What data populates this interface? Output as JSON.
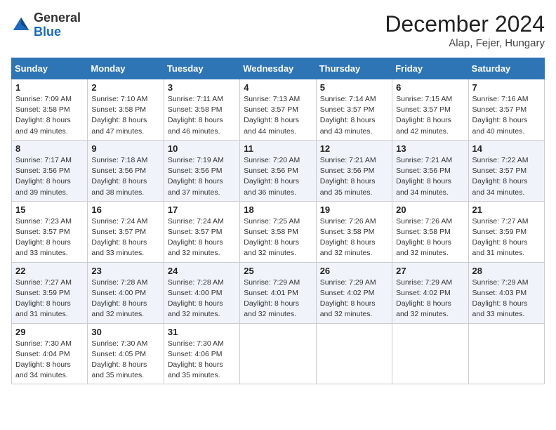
{
  "logo": {
    "general": "General",
    "blue": "Blue"
  },
  "header": {
    "month": "December 2024",
    "location": "Alap, Fejer, Hungary"
  },
  "weekdays": [
    "Sunday",
    "Monday",
    "Tuesday",
    "Wednesday",
    "Thursday",
    "Friday",
    "Saturday"
  ],
  "weeks": [
    [
      {
        "day": "1",
        "sunrise": "7:09 AM",
        "sunset": "3:58 PM",
        "daylight": "8 hours and 49 minutes."
      },
      {
        "day": "2",
        "sunrise": "7:10 AM",
        "sunset": "3:58 PM",
        "daylight": "8 hours and 47 minutes."
      },
      {
        "day": "3",
        "sunrise": "7:11 AM",
        "sunset": "3:58 PM",
        "daylight": "8 hours and 46 minutes."
      },
      {
        "day": "4",
        "sunrise": "7:13 AM",
        "sunset": "3:57 PM",
        "daylight": "8 hours and 44 minutes."
      },
      {
        "day": "5",
        "sunrise": "7:14 AM",
        "sunset": "3:57 PM",
        "daylight": "8 hours and 43 minutes."
      },
      {
        "day": "6",
        "sunrise": "7:15 AM",
        "sunset": "3:57 PM",
        "daylight": "8 hours and 42 minutes."
      },
      {
        "day": "7",
        "sunrise": "7:16 AM",
        "sunset": "3:57 PM",
        "daylight": "8 hours and 40 minutes."
      }
    ],
    [
      {
        "day": "8",
        "sunrise": "7:17 AM",
        "sunset": "3:56 PM",
        "daylight": "8 hours and 39 minutes."
      },
      {
        "day": "9",
        "sunrise": "7:18 AM",
        "sunset": "3:56 PM",
        "daylight": "8 hours and 38 minutes."
      },
      {
        "day": "10",
        "sunrise": "7:19 AM",
        "sunset": "3:56 PM",
        "daylight": "8 hours and 37 minutes."
      },
      {
        "day": "11",
        "sunrise": "7:20 AM",
        "sunset": "3:56 PM",
        "daylight": "8 hours and 36 minutes."
      },
      {
        "day": "12",
        "sunrise": "7:21 AM",
        "sunset": "3:56 PM",
        "daylight": "8 hours and 35 minutes."
      },
      {
        "day": "13",
        "sunrise": "7:21 AM",
        "sunset": "3:56 PM",
        "daylight": "8 hours and 34 minutes."
      },
      {
        "day": "14",
        "sunrise": "7:22 AM",
        "sunset": "3:57 PM",
        "daylight": "8 hours and 34 minutes."
      }
    ],
    [
      {
        "day": "15",
        "sunrise": "7:23 AM",
        "sunset": "3:57 PM",
        "daylight": "8 hours and 33 minutes."
      },
      {
        "day": "16",
        "sunrise": "7:24 AM",
        "sunset": "3:57 PM",
        "daylight": "8 hours and 33 minutes."
      },
      {
        "day": "17",
        "sunrise": "7:24 AM",
        "sunset": "3:57 PM",
        "daylight": "8 hours and 32 minutes."
      },
      {
        "day": "18",
        "sunrise": "7:25 AM",
        "sunset": "3:58 PM",
        "daylight": "8 hours and 32 minutes."
      },
      {
        "day": "19",
        "sunrise": "7:26 AM",
        "sunset": "3:58 PM",
        "daylight": "8 hours and 32 minutes."
      },
      {
        "day": "20",
        "sunrise": "7:26 AM",
        "sunset": "3:58 PM",
        "daylight": "8 hours and 32 minutes."
      },
      {
        "day": "21",
        "sunrise": "7:27 AM",
        "sunset": "3:59 PM",
        "daylight": "8 hours and 31 minutes."
      }
    ],
    [
      {
        "day": "22",
        "sunrise": "7:27 AM",
        "sunset": "3:59 PM",
        "daylight": "8 hours and 31 minutes."
      },
      {
        "day": "23",
        "sunrise": "7:28 AM",
        "sunset": "4:00 PM",
        "daylight": "8 hours and 32 minutes."
      },
      {
        "day": "24",
        "sunrise": "7:28 AM",
        "sunset": "4:00 PM",
        "daylight": "8 hours and 32 minutes."
      },
      {
        "day": "25",
        "sunrise": "7:29 AM",
        "sunset": "4:01 PM",
        "daylight": "8 hours and 32 minutes."
      },
      {
        "day": "26",
        "sunrise": "7:29 AM",
        "sunset": "4:02 PM",
        "daylight": "8 hours and 32 minutes."
      },
      {
        "day": "27",
        "sunrise": "7:29 AM",
        "sunset": "4:02 PM",
        "daylight": "8 hours and 32 minutes."
      },
      {
        "day": "28",
        "sunrise": "7:29 AM",
        "sunset": "4:03 PM",
        "daylight": "8 hours and 33 minutes."
      }
    ],
    [
      {
        "day": "29",
        "sunrise": "7:30 AM",
        "sunset": "4:04 PM",
        "daylight": "8 hours and 34 minutes."
      },
      {
        "day": "30",
        "sunrise": "7:30 AM",
        "sunset": "4:05 PM",
        "daylight": "8 hours and 35 minutes."
      },
      {
        "day": "31",
        "sunrise": "7:30 AM",
        "sunset": "4:06 PM",
        "daylight": "8 hours and 35 minutes."
      },
      null,
      null,
      null,
      null
    ]
  ],
  "labels": {
    "sunrise": "Sunrise:",
    "sunset": "Sunset:",
    "daylight": "Daylight:"
  }
}
